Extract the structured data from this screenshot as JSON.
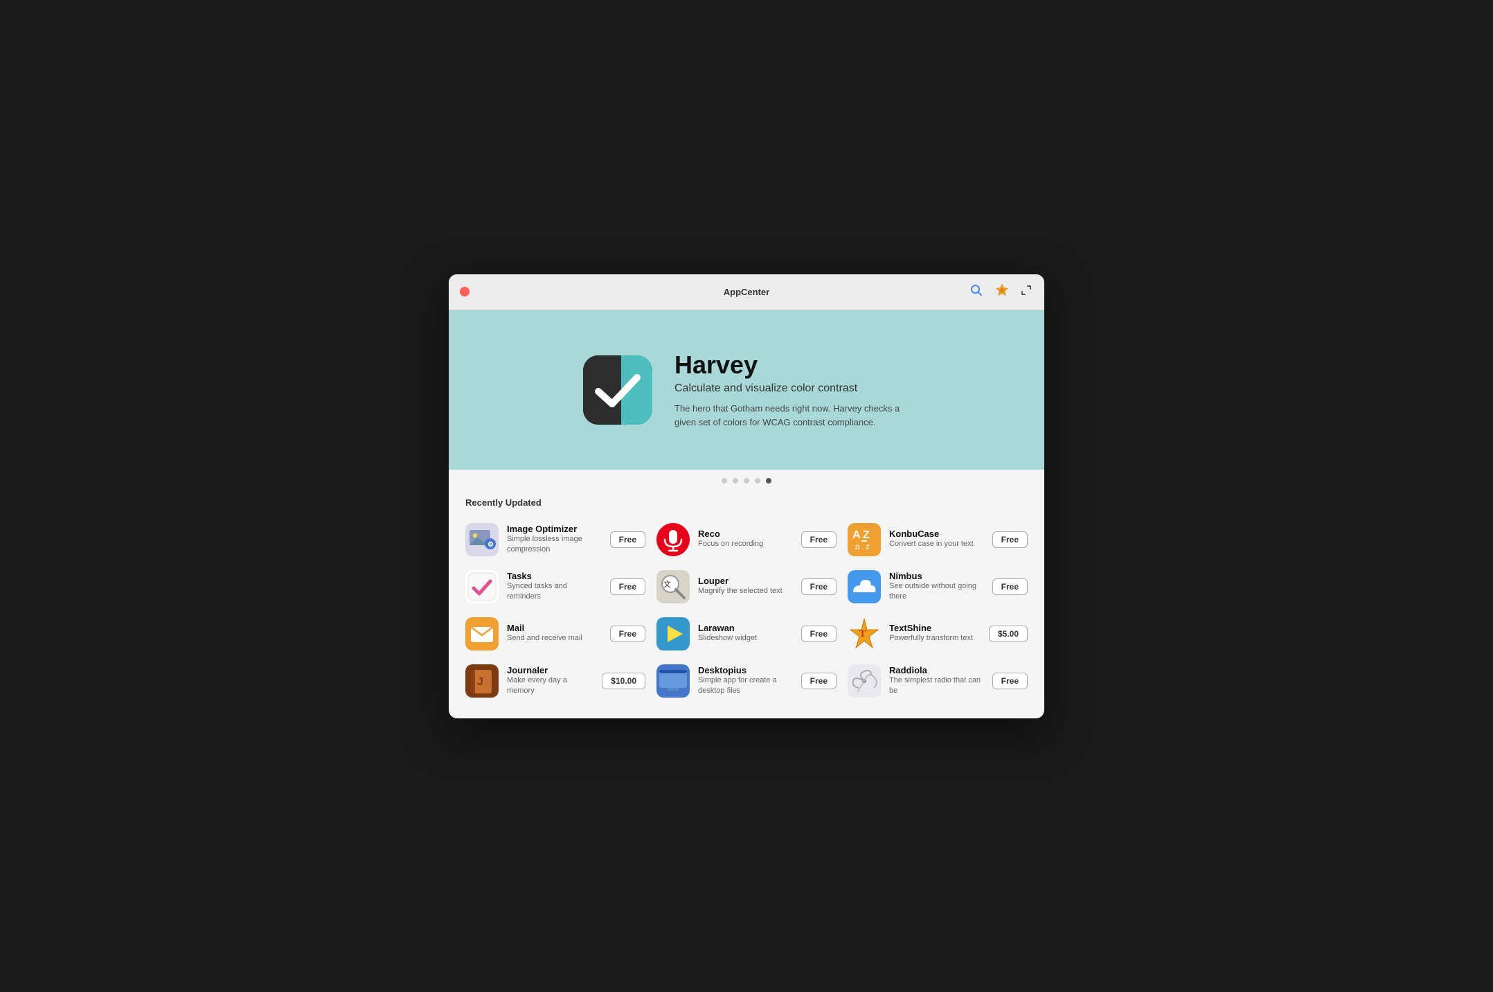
{
  "window": {
    "title": "AppCenter"
  },
  "titlebar": {
    "close_label": "×",
    "search_label": "🔍",
    "badge_label": "🏅",
    "expand_label": "⤢"
  },
  "hero": {
    "app_name": "Harvey",
    "app_subtitle": "Calculate and visualize color contrast",
    "app_desc": "The hero that Gotham needs right now. Harvey checks a given set of colors for WCAG contrast compliance."
  },
  "dots": [
    {
      "active": false
    },
    {
      "active": false
    },
    {
      "active": false
    },
    {
      "active": false
    },
    {
      "active": true
    }
  ],
  "section": {
    "title": "Recently Updated"
  },
  "apps": [
    {
      "name": "Image Optimizer",
      "desc": "Simple lossless image compression",
      "price": "Free",
      "icon_type": "image-optimizer"
    },
    {
      "name": "Reco",
      "desc": "Focus on recording",
      "price": "Free",
      "icon_type": "reco"
    },
    {
      "name": "KonbuCase",
      "desc": "Convert case in your text",
      "price": "Free",
      "icon_type": "konbucase"
    },
    {
      "name": "Tasks",
      "desc": "Synced tasks and reminders",
      "price": "Free",
      "icon_type": "tasks"
    },
    {
      "name": "Louper",
      "desc": "Magnify the selected text",
      "price": "Free",
      "icon_type": "louper"
    },
    {
      "name": "Nimbus",
      "desc": "See outside without going there",
      "price": "Free",
      "icon_type": "nimbus"
    },
    {
      "name": "Mail",
      "desc": "Send and receive mail",
      "price": "Free",
      "icon_type": "mail"
    },
    {
      "name": "Larawan",
      "desc": "Slideshow widget",
      "price": "Free",
      "icon_type": "larawan"
    },
    {
      "name": "TextShine",
      "desc": "Powerfully transform text",
      "price": "$5.00",
      "icon_type": "textshine"
    },
    {
      "name": "Journaler",
      "desc": "Make every day a memory",
      "price": "$10.00",
      "icon_type": "journaler"
    },
    {
      "name": "Desktopius",
      "desc": "Simple app for create a desktop files",
      "price": "Free",
      "icon_type": "desktopius"
    },
    {
      "name": "Raddiola",
      "desc": "The simplest radio that can be",
      "price": "Free",
      "icon_type": "raddiola"
    }
  ]
}
